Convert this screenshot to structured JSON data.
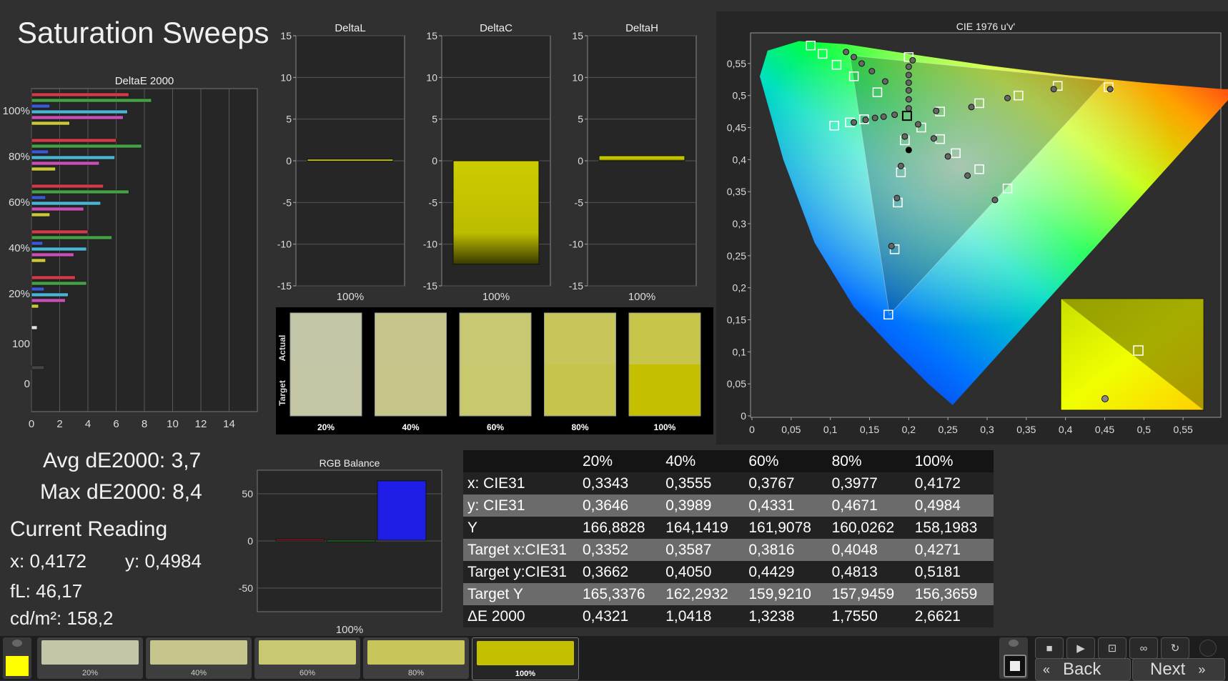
{
  "page_title": "Saturation Sweeps",
  "stats": {
    "avg": "Avg dE2000: 3,7",
    "max": "Max dE2000: 8,4",
    "current_title": "Current Reading",
    "x": "x: 0,4172",
    "y": "y: 0,4984",
    "fl": "fL: 46,17",
    "cdm2": "cd/m²: 158,2"
  },
  "deltae_chart": {
    "title": "DeltaE 2000",
    "type": "bar",
    "x_ticks": [
      "0",
      "2",
      "4",
      "6",
      "8",
      "10",
      "12",
      "14"
    ],
    "xlim": [
      0,
      16
    ],
    "groups": [
      {
        "label": "100%",
        "values": [
          6.9,
          8.5,
          1.3,
          6.8,
          6.5,
          2.7
        ]
      },
      {
        "label": "80%",
        "values": [
          6.0,
          7.8,
          1.2,
          5.9,
          4.8,
          1.7
        ]
      },
      {
        "label": "60%",
        "values": [
          5.1,
          6.9,
          1.0,
          4.9,
          3.7,
          1.3
        ]
      },
      {
        "label": "40%",
        "values": [
          4.0,
          5.7,
          0.8,
          3.9,
          3.0,
          1.0
        ]
      },
      {
        "label": "20%",
        "values": [
          3.1,
          3.9,
          0.9,
          2.6,
          2.4,
          0.5
        ]
      },
      {
        "label": "100",
        "values": [
          0.4
        ]
      },
      {
        "label": "0",
        "values": [
          0.9
        ]
      }
    ],
    "series_colors": [
      "#d23a4a",
      "#46a046",
      "#3a5ad2",
      "#4ab4d2",
      "#c850b4",
      "#c8c83a"
    ]
  },
  "delta_charts": [
    {
      "title": "DeltaL",
      "category": "100%",
      "value": 0.2,
      "yticks": [
        "15",
        "10",
        "5",
        "0",
        "-5",
        "-10",
        "-15"
      ],
      "ylim": [
        -15,
        15
      ]
    },
    {
      "title": "DeltaC",
      "category": "100%",
      "value": -12.4,
      "yticks": [
        "15",
        "10",
        "5",
        "0",
        "-5",
        "-10",
        "-15"
      ],
      "ylim": [
        -15,
        15
      ]
    },
    {
      "title": "DeltaH",
      "category": "100%",
      "value": 0.6,
      "yticks": [
        "15",
        "10",
        "5",
        "0",
        "-5",
        "-10",
        "-15"
      ],
      "ylim": [
        -15,
        15
      ]
    }
  ],
  "swatches": {
    "actual_label": "Actual",
    "target_label": "Target",
    "items": [
      {
        "label": "20%",
        "actual": "#c4c6a8",
        "target": "#c4c6a6"
      },
      {
        "label": "40%",
        "actual": "#c6c68c",
        "target": "#c6c68a"
      },
      {
        "label": "60%",
        "actual": "#c8c872",
        "target": "#c8c86e"
      },
      {
        "label": "80%",
        "actual": "#c8c65a",
        "target": "#c6c44a"
      },
      {
        "label": "100%",
        "actual": "#c8c64a",
        "target": "#c4c000"
      }
    ]
  },
  "rgb_balance": {
    "title": "RGB Balance",
    "category": "100%",
    "yticks": [
      "50",
      "0",
      "-50"
    ],
    "ylim": [
      -75,
      75
    ],
    "values": [
      {
        "color": "#c81e1e",
        "value": 1
      },
      {
        "color": "#1e9a1e",
        "value": 0
      },
      {
        "color": "#1e1ee6",
        "value": 63
      }
    ]
  },
  "table": {
    "headers": [
      "",
      "20%",
      "40%",
      "60%",
      "80%",
      "100%"
    ],
    "rows": [
      {
        "label": "x: CIE31",
        "values": [
          "0,3343",
          "0,3555",
          "0,3767",
          "0,3977",
          "0,4172"
        ]
      },
      {
        "label": "y: CIE31",
        "values": [
          "0,3646",
          "0,3989",
          "0,4331",
          "0,4671",
          "0,4984"
        ]
      },
      {
        "label": "Y",
        "values": [
          "166,8828",
          "164,1419",
          "161,9078",
          "160,0262",
          "158,1983"
        ]
      },
      {
        "label": "Target x:CIE31",
        "values": [
          "0,3352",
          "0,3587",
          "0,3816",
          "0,4048",
          "0,4271"
        ]
      },
      {
        "label": "Target y:CIE31",
        "values": [
          "0,3662",
          "0,4050",
          "0,4429",
          "0,4813",
          "0,5181"
        ]
      },
      {
        "label": "Target Y",
        "values": [
          "165,3376",
          "162,2932",
          "159,9210",
          "157,9459",
          "156,3659"
        ]
      },
      {
        "label": "ΔE 2000",
        "values": [
          "0,4321",
          "1,0418",
          "1,3238",
          "1,7550",
          "2,6621"
        ]
      }
    ]
  },
  "cie_chart": {
    "title": "CIE 1976 u'v'",
    "type": "scatter",
    "xticks": [
      "0",
      "0,05",
      "0,1",
      "0,15",
      "0,2",
      "0,25",
      "0,3",
      "0,35",
      "0,4",
      "0,45",
      "0,5",
      "0,55"
    ],
    "yticks": [
      "0",
      "0,05",
      "0,1",
      "0,15",
      "0,2",
      "0,25",
      "0,3",
      "0,35",
      "0,4",
      "0,45",
      "0,5",
      "0,55"
    ],
    "xlim": [
      0,
      0.6
    ],
    "ylim": [
      0,
      0.6
    ],
    "locus": [
      [
        0.256,
        0.017
      ],
      [
        0.225,
        0.05
      ],
      [
        0.18,
        0.105
      ],
      [
        0.13,
        0.17
      ],
      [
        0.08,
        0.27
      ],
      [
        0.04,
        0.4
      ],
      [
        0.01,
        0.53
      ],
      [
        0.02,
        0.57
      ],
      [
        0.06,
        0.585
      ],
      [
        0.12,
        0.58
      ],
      [
        0.2,
        0.565
      ],
      [
        0.3,
        0.547
      ],
      [
        0.4,
        0.532
      ],
      [
        0.5,
        0.52
      ],
      [
        0.6,
        0.51
      ],
      [
        0.62,
        0.51
      ]
    ],
    "gamut": [
      [
        0.4507,
        0.5229
      ],
      [
        0.125,
        0.5625
      ],
      [
        0.1754,
        0.1579
      ]
    ],
    "white_target": [
      0.1978,
      0.4683
    ],
    "targets": [
      [
        0.075,
        0.578
      ],
      [
        0.09,
        0.565
      ],
      [
        0.108,
        0.548
      ],
      [
        0.13,
        0.53
      ],
      [
        0.16,
        0.505
      ],
      [
        0.2,
        0.56
      ],
      [
        0.455,
        0.513
      ],
      [
        0.39,
        0.515
      ],
      [
        0.34,
        0.5
      ],
      [
        0.29,
        0.488
      ],
      [
        0.24,
        0.475
      ],
      [
        0.105,
        0.453
      ],
      [
        0.125,
        0.458
      ],
      [
        0.143,
        0.463
      ],
      [
        0.216,
        0.45
      ],
      [
        0.24,
        0.432
      ],
      [
        0.26,
        0.41
      ],
      [
        0.29,
        0.385
      ],
      [
        0.326,
        0.355
      ],
      [
        0.195,
        0.43
      ],
      [
        0.19,
        0.38
      ],
      [
        0.186,
        0.333
      ],
      [
        0.182,
        0.26
      ],
      [
        0.174,
        0.158
      ]
    ],
    "measured": [
      [
        0.12,
        0.568
      ],
      [
        0.13,
        0.56
      ],
      [
        0.14,
        0.55
      ],
      [
        0.153,
        0.538
      ],
      [
        0.17,
        0.522
      ],
      [
        0.205,
        0.555
      ],
      [
        0.2,
        0.545
      ],
      [
        0.2,
        0.532
      ],
      [
        0.2,
        0.52
      ],
      [
        0.2,
        0.508
      ],
      [
        0.2,
        0.494
      ],
      [
        0.2,
        0.48
      ],
      [
        0.457,
        0.51
      ],
      [
        0.385,
        0.51
      ],
      [
        0.326,
        0.496
      ],
      [
        0.28,
        0.482
      ],
      [
        0.235,
        0.476
      ],
      [
        0.13,
        0.458
      ],
      [
        0.145,
        0.462
      ],
      [
        0.157,
        0.465
      ],
      [
        0.168,
        0.467
      ],
      [
        0.182,
        0.47
      ],
      [
        0.212,
        0.455
      ],
      [
        0.232,
        0.433
      ],
      [
        0.25,
        0.405
      ],
      [
        0.275,
        0.375
      ],
      [
        0.31,
        0.337
      ],
      [
        0.195,
        0.436
      ],
      [
        0.19,
        0.39
      ],
      [
        0.185,
        0.34
      ],
      [
        0.178,
        0.265
      ]
    ],
    "current": [
      0.2,
      0.415
    ]
  },
  "bottom_bar": {
    "current_color": "#ffff00",
    "thumbs": [
      {
        "label": "20%",
        "color": "#c4c6a8"
      },
      {
        "label": "40%",
        "color": "#c6c68c"
      },
      {
        "label": "60%",
        "color": "#c8c872"
      },
      {
        "label": "80%",
        "color": "#c8c65a"
      },
      {
        "label": "100%",
        "color": "#c4c000"
      }
    ],
    "back_label": "Back",
    "next_label": "Next"
  }
}
